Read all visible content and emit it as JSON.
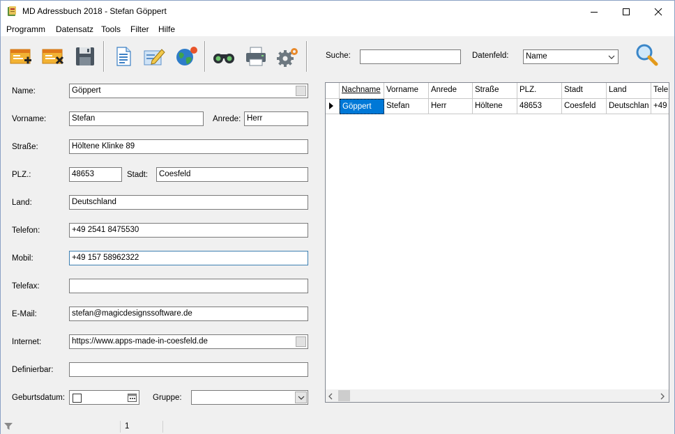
{
  "window": {
    "title": "MD Adressbuch 2018 - Stefan Göppert"
  },
  "menu": [
    "Programm",
    "Datensatz",
    "Tools",
    "Filter",
    "Hilfe"
  ],
  "toolbar": {
    "search_label": "Suche:",
    "search_value": "",
    "datafield_label": "Datenfeld:",
    "datafield_value": "Name"
  },
  "form": {
    "name_label": "Name:",
    "name_value": "Göppert",
    "vorname_label": "Vorname:",
    "vorname_value": "Stefan",
    "anrede_label": "Anrede:",
    "anrede_value": "Herr",
    "strasse_label": "Straße:",
    "strasse_value": "Höltene Klinke 89",
    "plz_label": "PLZ.:",
    "plz_value": "48653",
    "stadt_label": "Stadt:",
    "stadt_value": "Coesfeld",
    "land_label": "Land:",
    "land_value": "Deutschland",
    "telefon_label": "Telefon:",
    "telefon_value": "+49 2541 8475530",
    "mobil_label": "Mobil:",
    "mobil_value": "+49 157 58962322",
    "telefax_label": "Telefax:",
    "telefax_value": "",
    "email_label": "E-Mail:",
    "email_value": "stefan@magicdesignssoftware.de",
    "internet_label": "Internet:",
    "internet_value": "https://www.apps-made-in-coesfeld.de",
    "definierbar_label": "Definierbar:",
    "definierbar_value": "",
    "geburtsdatum_label": "Geburtsdatum:",
    "gruppe_label": "Gruppe:",
    "gruppe_value": ""
  },
  "grid": {
    "columns": [
      "Nachname",
      "Vorname",
      "Anrede",
      "Straße",
      "PLZ.",
      "Stadt",
      "Land",
      "Tele"
    ],
    "rows": [
      [
        "Göppert",
        "Stefan",
        "Herr",
        "Höltene",
        "48653",
        "Coesfeld",
        "Deutschlan",
        "+49"
      ]
    ]
  },
  "status": {
    "count": "1"
  }
}
